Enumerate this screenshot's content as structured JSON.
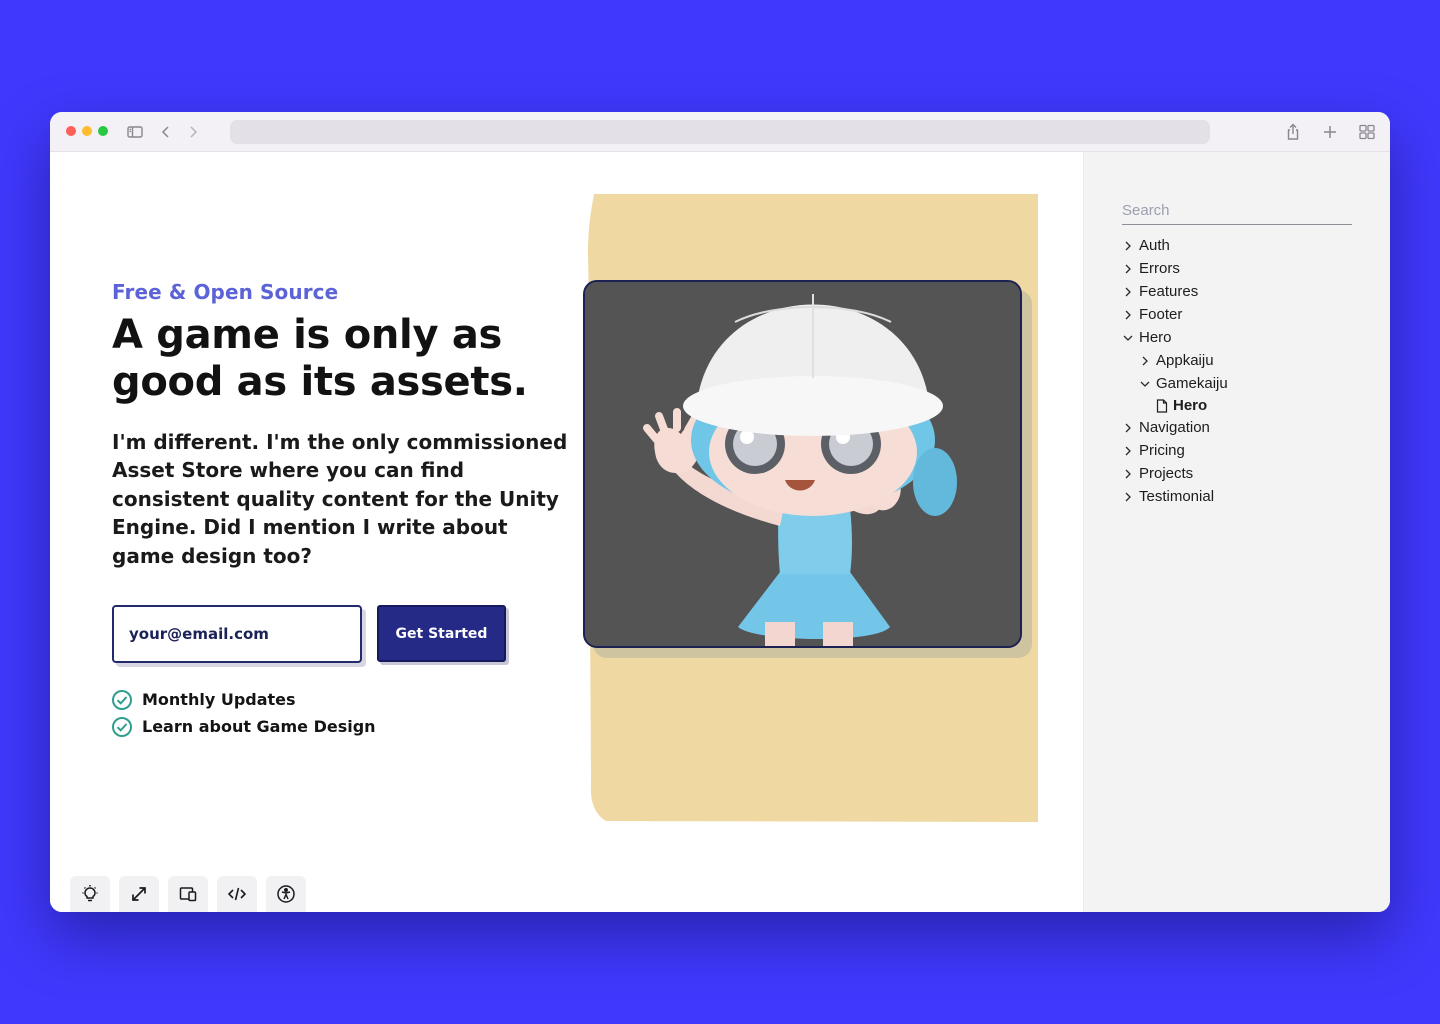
{
  "hero": {
    "eyebrow": "Free & Open Source",
    "headline": "A game is only as good as its assets.",
    "lead": "I'm different. I'm the only commissioned Asset Store where you can find consistent quality content for the Unity Engine. Did I mention I write about game design too?",
    "email_placeholder": "your@email.com",
    "cta_label": "Get Started",
    "checklist": [
      "Monthly Updates",
      "Learn about Game Design"
    ]
  },
  "sidebar": {
    "search_placeholder": "Search",
    "tree": [
      {
        "label": "Auth",
        "state": "collapsed"
      },
      {
        "label": "Errors",
        "state": "collapsed"
      },
      {
        "label": "Features",
        "state": "collapsed"
      },
      {
        "label": "Footer",
        "state": "collapsed"
      },
      {
        "label": "Hero",
        "state": "expanded"
      },
      {
        "label": "Appkaiju",
        "state": "collapsed"
      },
      {
        "label": "Gamekaiju",
        "state": "expanded"
      },
      {
        "label": "Hero",
        "state": "selected"
      },
      {
        "label": "Navigation",
        "state": "collapsed"
      },
      {
        "label": "Pricing",
        "state": "collapsed"
      },
      {
        "label": "Projects",
        "state": "collapsed"
      },
      {
        "label": "Testimonial",
        "state": "collapsed"
      }
    ]
  },
  "browser": {
    "icons": [
      "sidebar-toggle-icon",
      "back-icon",
      "forward-icon",
      "share-icon",
      "new-tab-icon",
      "tab-overview-icon"
    ]
  },
  "toolbar": {
    "icons": [
      "lightbulb-icon",
      "expand-icon",
      "responsive-icon",
      "code-icon",
      "accessibility-icon"
    ]
  },
  "colors": {
    "page_background": "#4039fd",
    "accent": "#5b63d6",
    "cta": "#252a86",
    "art_backdrop": "#f0d8a2",
    "check": "#2f9e8f"
  }
}
